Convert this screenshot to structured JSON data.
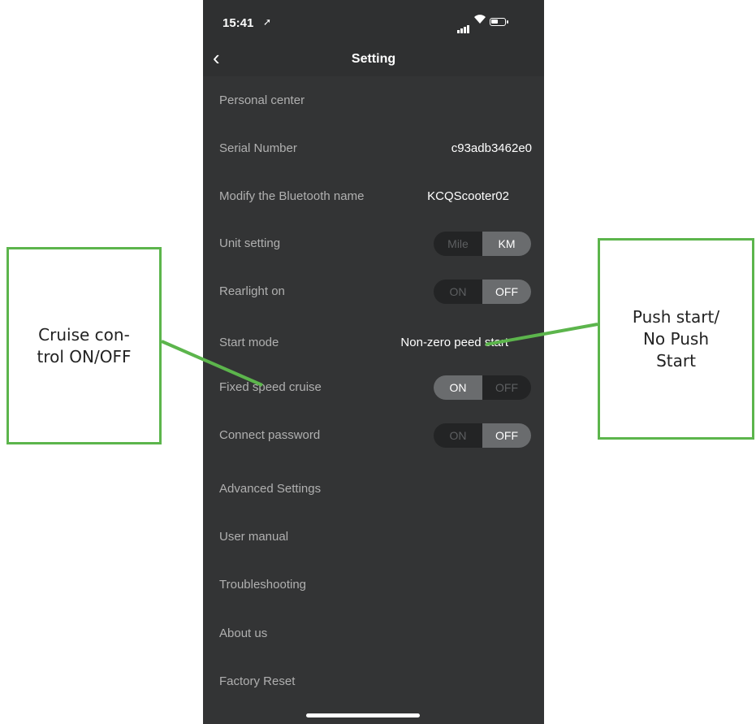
{
  "status_bar": {
    "time": "15:41",
    "location_glyph": "➚"
  },
  "navbar": {
    "back_icon": "‹",
    "title": "Setting"
  },
  "settings": {
    "personal_center": "Personal center",
    "serial_number": {
      "label": "Serial Number",
      "value": "c93adb3462e0"
    },
    "bluetooth_name": {
      "label": "Modify the Bluetooth name",
      "value": "KCQScooter02"
    },
    "unit_setting": {
      "label": "Unit setting",
      "left": "Mile",
      "right": "KM",
      "selected": "KM"
    },
    "rearlight": {
      "label": "Rearlight on",
      "left": "ON",
      "right": "OFF",
      "selected": "OFF"
    },
    "start_mode": {
      "label": "Start mode",
      "value": "Non-zero peed start"
    },
    "fixed_speed_cruise": {
      "label": "Fixed speed cruise",
      "left": "ON",
      "right": "OFF",
      "selected": "ON"
    },
    "connect_password": {
      "label": "Connect password",
      "left": "ON",
      "right": "OFF",
      "selected": "OFF"
    },
    "advanced_settings": "Advanced Settings",
    "user_manual": "User manual",
    "troubleshooting": "Troubleshooting",
    "about_us": "About us",
    "factory_reset": "Factory Reset"
  },
  "annotations": {
    "left_callout": {
      "line1": "Cruise con-",
      "line2": "trol ON/OFF"
    },
    "right_callout": {
      "line1": "Push start/",
      "line2": "No Push",
      "line3": "Start"
    },
    "accent_color": "#5cb54c"
  }
}
